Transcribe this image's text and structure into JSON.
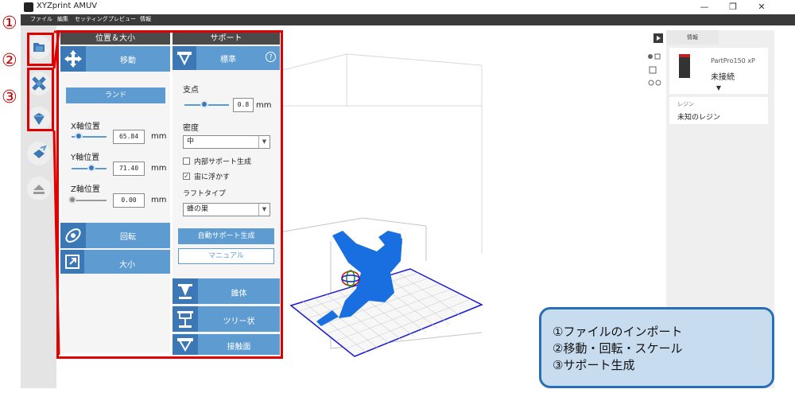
{
  "app": {
    "title": "XYZprint AMUV"
  },
  "window_controls": {
    "minimize": "—",
    "maximize": "❐",
    "close": "✕"
  },
  "menu": {
    "items": [
      "ファイル",
      "編集",
      "セッティング",
      "プレビュー",
      "情報"
    ]
  },
  "annotation_numbers": {
    "n1": "①",
    "n2": "②",
    "n3": "③"
  },
  "position_panel": {
    "header": "位置＆大小",
    "move_label": "移動",
    "land_label": "ランド",
    "x_label": "X軸位置",
    "x_value": "65.84",
    "y_label": "Y軸位置",
    "y_value": "71.40",
    "z_label": "Z軸位置",
    "z_value": "0.00",
    "unit": "mm",
    "rotate_label": "回転",
    "scale_label": "大小"
  },
  "support_panel": {
    "header": "サポート",
    "mode_label": "標準",
    "help_icon": "?",
    "point_label": "支点",
    "point_value": "0.8",
    "point_unit": "mm",
    "density_label": "密度",
    "density_value": "中",
    "internal_support_label": "内部サポート生成",
    "internal_support_checked": false,
    "float_label": "宙に浮かす",
    "float_checked": true,
    "raft_label": "ラフトタイプ",
    "raft_value": "蜂の巣",
    "auto_button": "自動サポート生成",
    "manual_button": "マニュアル",
    "cone_label": "錐体",
    "tree_label": "ツリー状",
    "contact_label": "接触面"
  },
  "right_panel": {
    "tab_label": "情報",
    "printer_name": "PartPro150 xP",
    "status": "未接続",
    "resin_label": "レジン",
    "resin_value": "未知のレジン"
  },
  "annotation_box": {
    "line1": "①ファイルのインポート",
    "line2": "②移動・回転・スケール",
    "line3": "③サポート生成"
  },
  "colors": {
    "accent": "#5d9bd0",
    "highlight_red": "#e00000",
    "model_blue": "#1a6fe0",
    "annotation_border": "#2a6eb5"
  }
}
